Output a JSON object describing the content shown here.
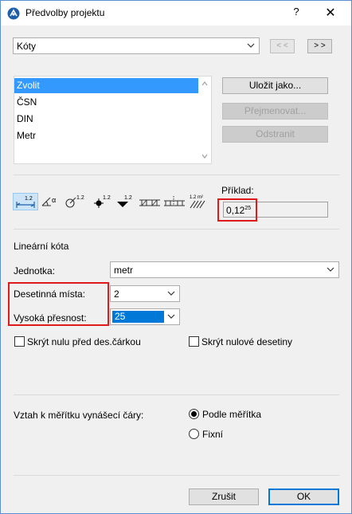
{
  "window": {
    "title": "Předvolby projektu",
    "help": "?",
    "close": "✕"
  },
  "category": {
    "selected": "Kóty",
    "prev": "< <",
    "next": "> >"
  },
  "presets": {
    "items": [
      "Zvolit",
      "ČSN",
      "DIN",
      "Metr"
    ],
    "selected_index": 0
  },
  "preset_buttons": {
    "save_as": "Uložit jako...",
    "rename": "Přejmenovat...",
    "delete": "Odstranit"
  },
  "example": {
    "label": "Příklad:",
    "value_main": "0,12",
    "value_sup": "25"
  },
  "dimension_types": {
    "labels": [
      "1.2",
      "α",
      "1.2",
      "1.2",
      "1.2",
      "",
      "",
      "1.2 m²"
    ]
  },
  "linear": {
    "section_title": "Lineární kóta",
    "unit_label": "Jednotka:",
    "unit_value": "metr",
    "decimals_label": "Desetinná místa:",
    "decimals_value": "2",
    "precision_label": "Vysoká přesnost:",
    "precision_value": "25",
    "hide_leading_zero": "Skrýt nulu před des.čárkou",
    "hide_trailing_zeros": "Skrýt nulové desetiny"
  },
  "scale": {
    "label": "Vztah k měřítku vynášecí čáry:",
    "option_scale": "Podle měřítka",
    "option_fixed": "Fixní",
    "selected": "Podle měřítka"
  },
  "footer": {
    "cancel": "Zrušit",
    "ok": "OK"
  },
  "colors": {
    "accent": "#0078d7",
    "selection": "#3399ff",
    "highlight_box": "#e01a1a"
  }
}
